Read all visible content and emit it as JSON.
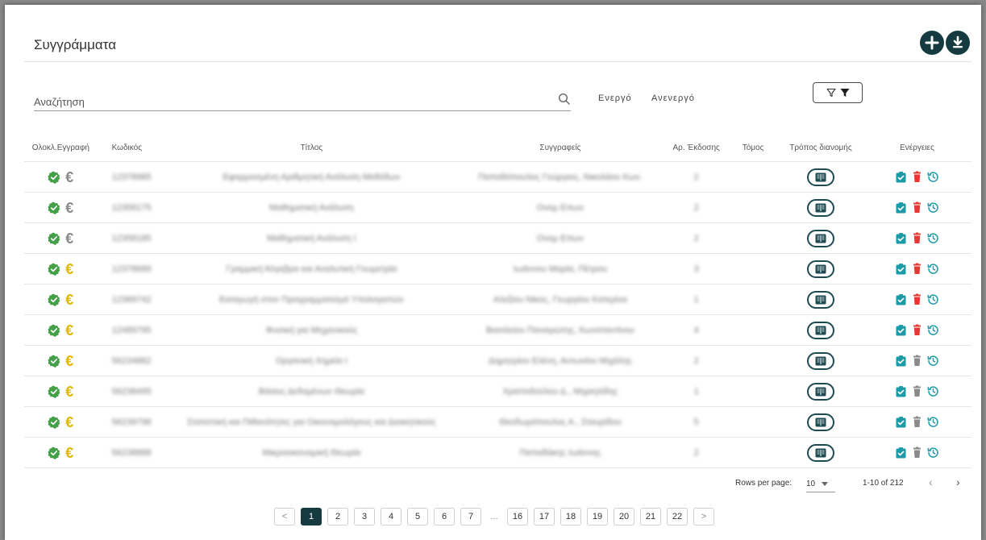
{
  "header": {
    "title": "Συγγράμματα",
    "add_icon": "plus-circle-icon",
    "download_icon": "download-circle-icon"
  },
  "search": {
    "placeholder": "Αναζήτηση",
    "value": ""
  },
  "filters": {
    "active_label": "Ενεργό",
    "inactive_label": "Ανενεργό",
    "filter_icon": "filter-icon"
  },
  "table": {
    "columns": [
      "Ολοκλ.Εγγραφή",
      "Κωδικός",
      "Τίτλος",
      "Συγγραφείς",
      "Αρ. Έκδοσης",
      "Τόμος",
      "Τρόπος διανομής",
      "Ενέργειες"
    ],
    "rows": [
      {
        "code": "12378985",
        "title": "Εφαρμοσμένη Αριθμητική Ανάλυση Μεθόδων",
        "authors": "Παπαδόπουλος Γεώργιος, Νικολάου Κων.",
        "edition": "2",
        "volume": "",
        "euro_color": "#8a8a8a",
        "delete_color": "#e53935"
      },
      {
        "code": "12358175",
        "title": "Μαθηματική Ανάλυση",
        "authors": "Ονομ Επων",
        "edition": "2",
        "volume": "",
        "euro_color": "#8a8a8a",
        "delete_color": "#e53935"
      },
      {
        "code": "12358185",
        "title": "Μαθηματική Ανάλυση Ι",
        "authors": "Ονομ Επων",
        "edition": "2",
        "volume": "",
        "euro_color": "#8a8a8a",
        "delete_color": "#e53935"
      },
      {
        "code": "12378689",
        "title": "Γραμμική Άλγεβρα και Αναλυτική Γεωμετρία",
        "authors": "Ιωάννου Μαρία, Πέτρου",
        "edition": "3",
        "volume": "",
        "euro_color": "#e0b800",
        "delete_color": "#e53935"
      },
      {
        "code": "12389742",
        "title": "Εισαγωγή στον Προγραμματισμό Υπολογιστών",
        "authors": "Αλεξίου Νίκος, Γεωργίου Κατερίνα",
        "edition": "1",
        "volume": "",
        "euro_color": "#e0b800",
        "delete_color": "#e53935"
      },
      {
        "code": "12489795",
        "title": "Φυσική για Μηχανικούς",
        "authors": "Βασιλείου Παναγιώτης, Κωνσταντίνου",
        "edition": "4",
        "volume": "",
        "euro_color": "#e0b800",
        "delete_color": "#e53935"
      },
      {
        "code": "56234882",
        "title": "Οργανική Χημεία Ι",
        "authors": "Δημητρίου Ελένη, Αντωνίου Μιχάλης",
        "edition": "2",
        "volume": "",
        "euro_color": "#e0b800",
        "delete_color": "#8a8a8a"
      },
      {
        "code": "56238495",
        "title": "Βάσεις Δεδομένων Θεωρία",
        "authors": "Χριστοδούλου Δ., Μιχαηλίδης",
        "edition": "1",
        "volume": "",
        "euro_color": "#e0b800",
        "delete_color": "#8a8a8a"
      },
      {
        "code": "56239798",
        "title": "Στατιστική και Πιθανότητες για Οικονομολόγους και Διοικητικούς",
        "authors": "Θεοδωρόπουλος Α., Σταυρίδου",
        "edition": "5",
        "volume": "",
        "euro_color": "#e0b800",
        "delete_color": "#8a8a8a"
      },
      {
        "code": "56238888",
        "title": "Μικροοικονομική Θεωρία",
        "authors": "Παπαδάκης Ιωάννης",
        "edition": "2",
        "volume": "",
        "euro_color": "#e0b800",
        "delete_color": "#8a8a8a"
      }
    ]
  },
  "table_pagination": {
    "rows_per_page_label": "Rows per page:",
    "rows_per_page_value": "10",
    "range": "1-10 of 212",
    "prev_icon": "chevron-left-icon",
    "next_icon": "chevron-right-icon"
  },
  "pager": {
    "prev": "<",
    "next": ">",
    "ellipsis": "...",
    "pages": [
      "1",
      "2",
      "3",
      "4",
      "5",
      "6",
      "7",
      "16",
      "17",
      "18",
      "19",
      "20",
      "21",
      "22"
    ],
    "active_page": "1"
  },
  "colors": {
    "accent": "#153b41",
    "check_green": "#43a047",
    "approve_teal": "#1a9ba5",
    "delete_red": "#e53935",
    "euro_yellow": "#e0b800",
    "euro_gray": "#8a8a8a"
  }
}
